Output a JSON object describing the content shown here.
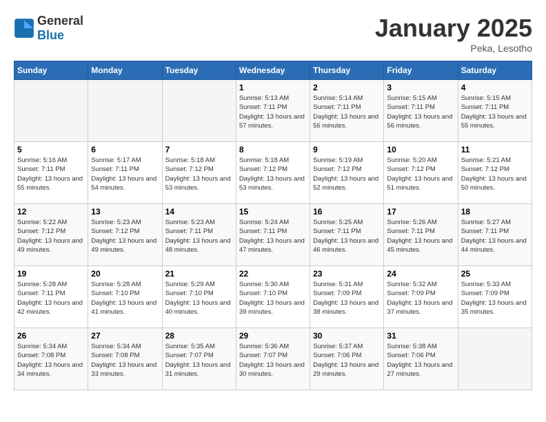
{
  "header": {
    "logo_general": "General",
    "logo_blue": "Blue",
    "month": "January 2025",
    "location": "Peka, Lesotho"
  },
  "days_of_week": [
    "Sunday",
    "Monday",
    "Tuesday",
    "Wednesday",
    "Thursday",
    "Friday",
    "Saturday"
  ],
  "weeks": [
    [
      {
        "day": "",
        "info": ""
      },
      {
        "day": "",
        "info": ""
      },
      {
        "day": "",
        "info": ""
      },
      {
        "day": "1",
        "sunrise": "Sunrise: 5:13 AM",
        "sunset": "Sunset: 7:11 PM",
        "daylight": "Daylight: 13 hours and 57 minutes."
      },
      {
        "day": "2",
        "sunrise": "Sunrise: 5:14 AM",
        "sunset": "Sunset: 7:11 PM",
        "daylight": "Daylight: 13 hours and 56 minutes."
      },
      {
        "day": "3",
        "sunrise": "Sunrise: 5:15 AM",
        "sunset": "Sunset: 7:11 PM",
        "daylight": "Daylight: 13 hours and 56 minutes."
      },
      {
        "day": "4",
        "sunrise": "Sunrise: 5:15 AM",
        "sunset": "Sunset: 7:11 PM",
        "daylight": "Daylight: 13 hours and 55 minutes."
      }
    ],
    [
      {
        "day": "5",
        "sunrise": "Sunrise: 5:16 AM",
        "sunset": "Sunset: 7:11 PM",
        "daylight": "Daylight: 13 hours and 55 minutes."
      },
      {
        "day": "6",
        "sunrise": "Sunrise: 5:17 AM",
        "sunset": "Sunset: 7:11 PM",
        "daylight": "Daylight: 13 hours and 54 minutes."
      },
      {
        "day": "7",
        "sunrise": "Sunrise: 5:18 AM",
        "sunset": "Sunset: 7:12 PM",
        "daylight": "Daylight: 13 hours and 53 minutes."
      },
      {
        "day": "8",
        "sunrise": "Sunrise: 5:18 AM",
        "sunset": "Sunset: 7:12 PM",
        "daylight": "Daylight: 13 hours and 53 minutes."
      },
      {
        "day": "9",
        "sunrise": "Sunrise: 5:19 AM",
        "sunset": "Sunset: 7:12 PM",
        "daylight": "Daylight: 13 hours and 52 minutes."
      },
      {
        "day": "10",
        "sunrise": "Sunrise: 5:20 AM",
        "sunset": "Sunset: 7:12 PM",
        "daylight": "Daylight: 13 hours and 51 minutes."
      },
      {
        "day": "11",
        "sunrise": "Sunrise: 5:21 AM",
        "sunset": "Sunset: 7:12 PM",
        "daylight": "Daylight: 13 hours and 50 minutes."
      }
    ],
    [
      {
        "day": "12",
        "sunrise": "Sunrise: 5:22 AM",
        "sunset": "Sunset: 7:12 PM",
        "daylight": "Daylight: 13 hours and 49 minutes."
      },
      {
        "day": "13",
        "sunrise": "Sunrise: 5:23 AM",
        "sunset": "Sunset: 7:12 PM",
        "daylight": "Daylight: 13 hours and 49 minutes."
      },
      {
        "day": "14",
        "sunrise": "Sunrise: 5:23 AM",
        "sunset": "Sunset: 7:11 PM",
        "daylight": "Daylight: 13 hours and 48 minutes."
      },
      {
        "day": "15",
        "sunrise": "Sunrise: 5:24 AM",
        "sunset": "Sunset: 7:11 PM",
        "daylight": "Daylight: 13 hours and 47 minutes."
      },
      {
        "day": "16",
        "sunrise": "Sunrise: 5:25 AM",
        "sunset": "Sunset: 7:11 PM",
        "daylight": "Daylight: 13 hours and 46 minutes."
      },
      {
        "day": "17",
        "sunrise": "Sunrise: 5:26 AM",
        "sunset": "Sunset: 7:11 PM",
        "daylight": "Daylight: 13 hours and 45 minutes."
      },
      {
        "day": "18",
        "sunrise": "Sunrise: 5:27 AM",
        "sunset": "Sunset: 7:11 PM",
        "daylight": "Daylight: 13 hours and 44 minutes."
      }
    ],
    [
      {
        "day": "19",
        "sunrise": "Sunrise: 5:28 AM",
        "sunset": "Sunset: 7:11 PM",
        "daylight": "Daylight: 13 hours and 42 minutes."
      },
      {
        "day": "20",
        "sunrise": "Sunrise: 5:28 AM",
        "sunset": "Sunset: 7:10 PM",
        "daylight": "Daylight: 13 hours and 41 minutes."
      },
      {
        "day": "21",
        "sunrise": "Sunrise: 5:29 AM",
        "sunset": "Sunset: 7:10 PM",
        "daylight": "Daylight: 13 hours and 40 minutes."
      },
      {
        "day": "22",
        "sunrise": "Sunrise: 5:30 AM",
        "sunset": "Sunset: 7:10 PM",
        "daylight": "Daylight: 13 hours and 39 minutes."
      },
      {
        "day": "23",
        "sunrise": "Sunrise: 5:31 AM",
        "sunset": "Sunset: 7:09 PM",
        "daylight": "Daylight: 13 hours and 38 minutes."
      },
      {
        "day": "24",
        "sunrise": "Sunrise: 5:32 AM",
        "sunset": "Sunset: 7:09 PM",
        "daylight": "Daylight: 13 hours and 37 minutes."
      },
      {
        "day": "25",
        "sunrise": "Sunrise: 5:33 AM",
        "sunset": "Sunset: 7:09 PM",
        "daylight": "Daylight: 13 hours and 35 minutes."
      }
    ],
    [
      {
        "day": "26",
        "sunrise": "Sunrise: 5:34 AM",
        "sunset": "Sunset: 7:08 PM",
        "daylight": "Daylight: 13 hours and 34 minutes."
      },
      {
        "day": "27",
        "sunrise": "Sunrise: 5:34 AM",
        "sunset": "Sunset: 7:08 PM",
        "daylight": "Daylight: 13 hours and 33 minutes."
      },
      {
        "day": "28",
        "sunrise": "Sunrise: 5:35 AM",
        "sunset": "Sunset: 7:07 PM",
        "daylight": "Daylight: 13 hours and 31 minutes."
      },
      {
        "day": "29",
        "sunrise": "Sunrise: 5:36 AM",
        "sunset": "Sunset: 7:07 PM",
        "daylight": "Daylight: 13 hours and 30 minutes."
      },
      {
        "day": "30",
        "sunrise": "Sunrise: 5:37 AM",
        "sunset": "Sunset: 7:06 PM",
        "daylight": "Daylight: 13 hours and 29 minutes."
      },
      {
        "day": "31",
        "sunrise": "Sunrise: 5:38 AM",
        "sunset": "Sunset: 7:06 PM",
        "daylight": "Daylight: 13 hours and 27 minutes."
      },
      {
        "day": "",
        "info": ""
      }
    ]
  ]
}
